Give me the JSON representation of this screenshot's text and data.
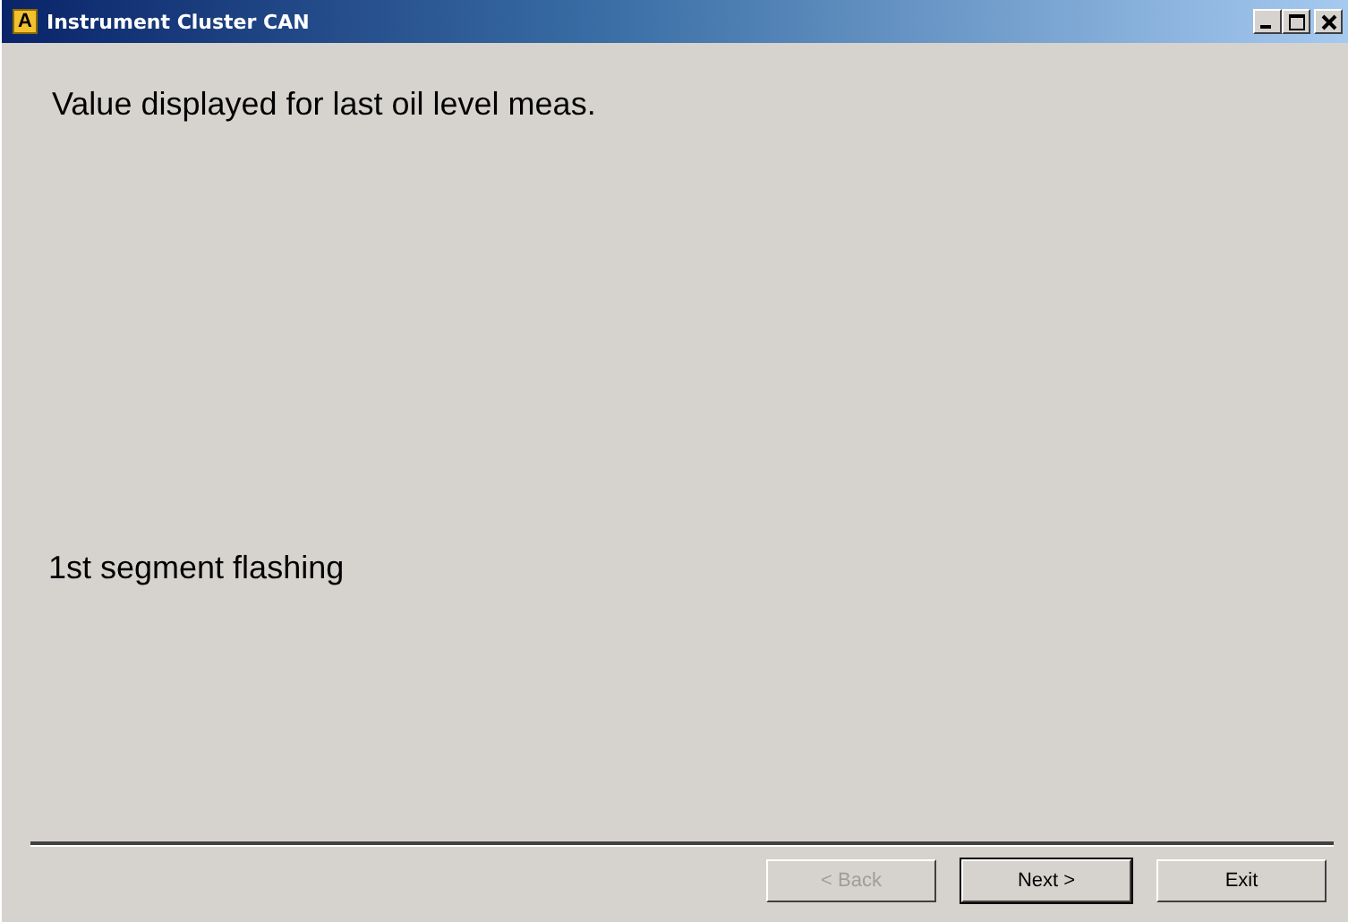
{
  "window": {
    "title": "Instrument Cluster CAN",
    "app_icon_letter": "A"
  },
  "message": "Value displayed for last oil level meas.",
  "status": "1st segment flashing",
  "buttons": [
    {
      "label": "< Back",
      "disabled": true,
      "default": false
    },
    {
      "label": "Next >",
      "disabled": false,
      "default": true
    },
    {
      "label": "Exit",
      "disabled": false,
      "default": false
    }
  ]
}
